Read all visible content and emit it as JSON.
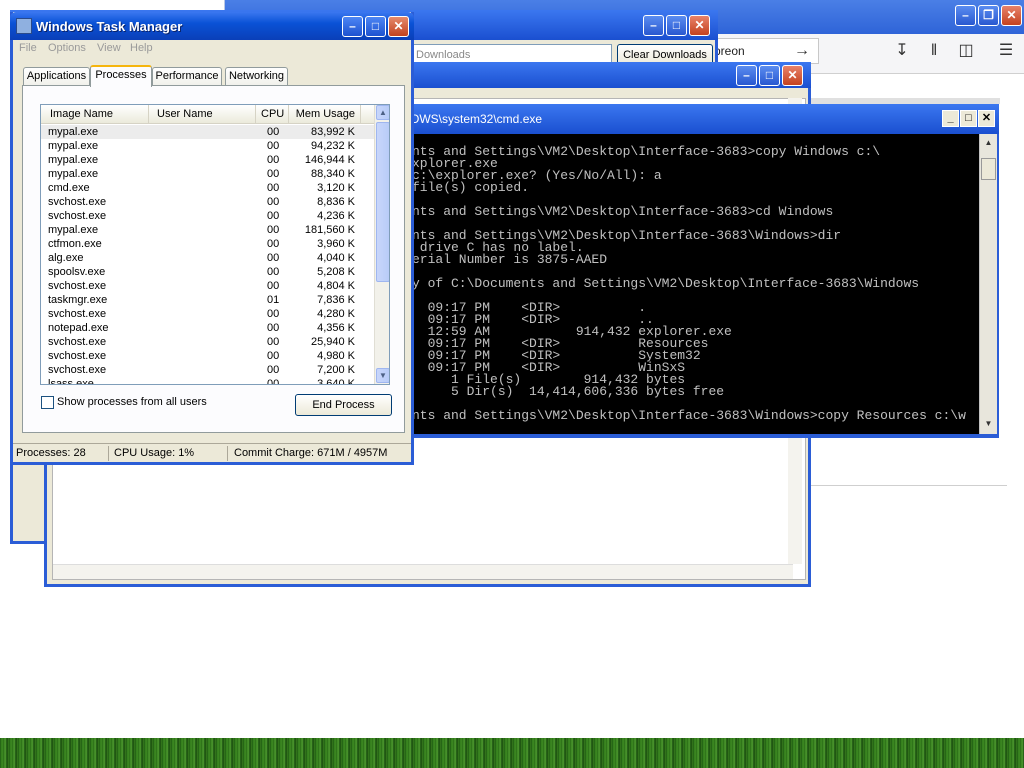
{
  "browser": {
    "url_fragment": "preon"
  },
  "library": {
    "search_placeholder": "Downloads",
    "clear_button": "Clear Downloads"
  },
  "cmd": {
    "title": "OWS\\system32\\cmd.exe",
    "lines": [
      "nts and Settings\\VM2\\Desktop\\Interface-3683>copy Windows c:\\",
      "xplorer.exe",
      "c:\\explorer.exe? (Yes/No/All): a",
      "file(s) copied.",
      "",
      "nts and Settings\\VM2\\Desktop\\Interface-3683>cd Windows",
      "",
      "nts and Settings\\VM2\\Desktop\\Interface-3683\\Windows>dir",
      " drive C has no label.",
      "erial Number is 3875-AAED",
      "",
      "y of C:\\Documents and Settings\\VM2\\Desktop\\Interface-3683\\Windows",
      "",
      "  09:17 PM    <DIR>          .",
      "  09:17 PM    <DIR>          ..",
      "  12:59 AM           914,432 explorer.exe",
      "  09:17 PM    <DIR>          Resources",
      "  09:17 PM    <DIR>          System32",
      "  09:17 PM    <DIR>          WinSxS",
      "     1 File(s)        914,432 bytes",
      "     5 Dir(s)  14,414,606,336 bytes free",
      "",
      "nts and Settings\\VM2\\Desktop\\Interface-3683\\Windows>copy Resources c:\\w"
    ]
  },
  "taskmgr": {
    "title": "Windows Task Manager",
    "menu": [
      "File",
      "Options",
      "View",
      "Help"
    ],
    "tabs": [
      "Applications",
      "Processes",
      "Performance",
      "Networking"
    ],
    "active_tab": "Processes",
    "columns": [
      "Image Name",
      "User Name",
      "CPU",
      "Mem Usage"
    ],
    "processes": [
      {
        "name": "mypal.exe",
        "user": "",
        "cpu": "00",
        "mem": "83,992 K"
      },
      {
        "name": "mypal.exe",
        "user": "",
        "cpu": "00",
        "mem": "94,232 K"
      },
      {
        "name": "mypal.exe",
        "user": "",
        "cpu": "00",
        "mem": "146,944 K"
      },
      {
        "name": "mypal.exe",
        "user": "",
        "cpu": "00",
        "mem": "88,340 K"
      },
      {
        "name": "cmd.exe",
        "user": "",
        "cpu": "00",
        "mem": "3,120 K"
      },
      {
        "name": "svchost.exe",
        "user": "",
        "cpu": "00",
        "mem": "8,836 K"
      },
      {
        "name": "svchost.exe",
        "user": "",
        "cpu": "00",
        "mem": "4,236 K"
      },
      {
        "name": "mypal.exe",
        "user": "",
        "cpu": "00",
        "mem": "181,560 K"
      },
      {
        "name": "ctfmon.exe",
        "user": "",
        "cpu": "00",
        "mem": "3,960 K"
      },
      {
        "name": "alg.exe",
        "user": "",
        "cpu": "00",
        "mem": "4,040 K"
      },
      {
        "name": "spoolsv.exe",
        "user": "",
        "cpu": "00",
        "mem": "5,208 K"
      },
      {
        "name": "svchost.exe",
        "user": "",
        "cpu": "00",
        "mem": "4,804 K"
      },
      {
        "name": "taskmgr.exe",
        "user": "",
        "cpu": "01",
        "mem": "7,836 K"
      },
      {
        "name": "svchost.exe",
        "user": "",
        "cpu": "00",
        "mem": "4,280 K"
      },
      {
        "name": "notepad.exe",
        "user": "",
        "cpu": "00",
        "mem": "4,356 K"
      },
      {
        "name": "svchost.exe",
        "user": "",
        "cpu": "00",
        "mem": "25,940 K"
      },
      {
        "name": "svchost.exe",
        "user": "",
        "cpu": "00",
        "mem": "4,980 K"
      },
      {
        "name": "svchost.exe",
        "user": "",
        "cpu": "00",
        "mem": "7,200 K"
      },
      {
        "name": "lsass.exe",
        "user": "",
        "cpu": "00",
        "mem": "3,640 K"
      }
    ],
    "show_all_label": "Show processes from all users",
    "show_all_checked": false,
    "end_process_label": "End Process",
    "status": {
      "processes": "Processes: 28",
      "cpu": "CPU Usage: 1%",
      "commit": "Commit Charge: 671M / 4957M"
    }
  }
}
